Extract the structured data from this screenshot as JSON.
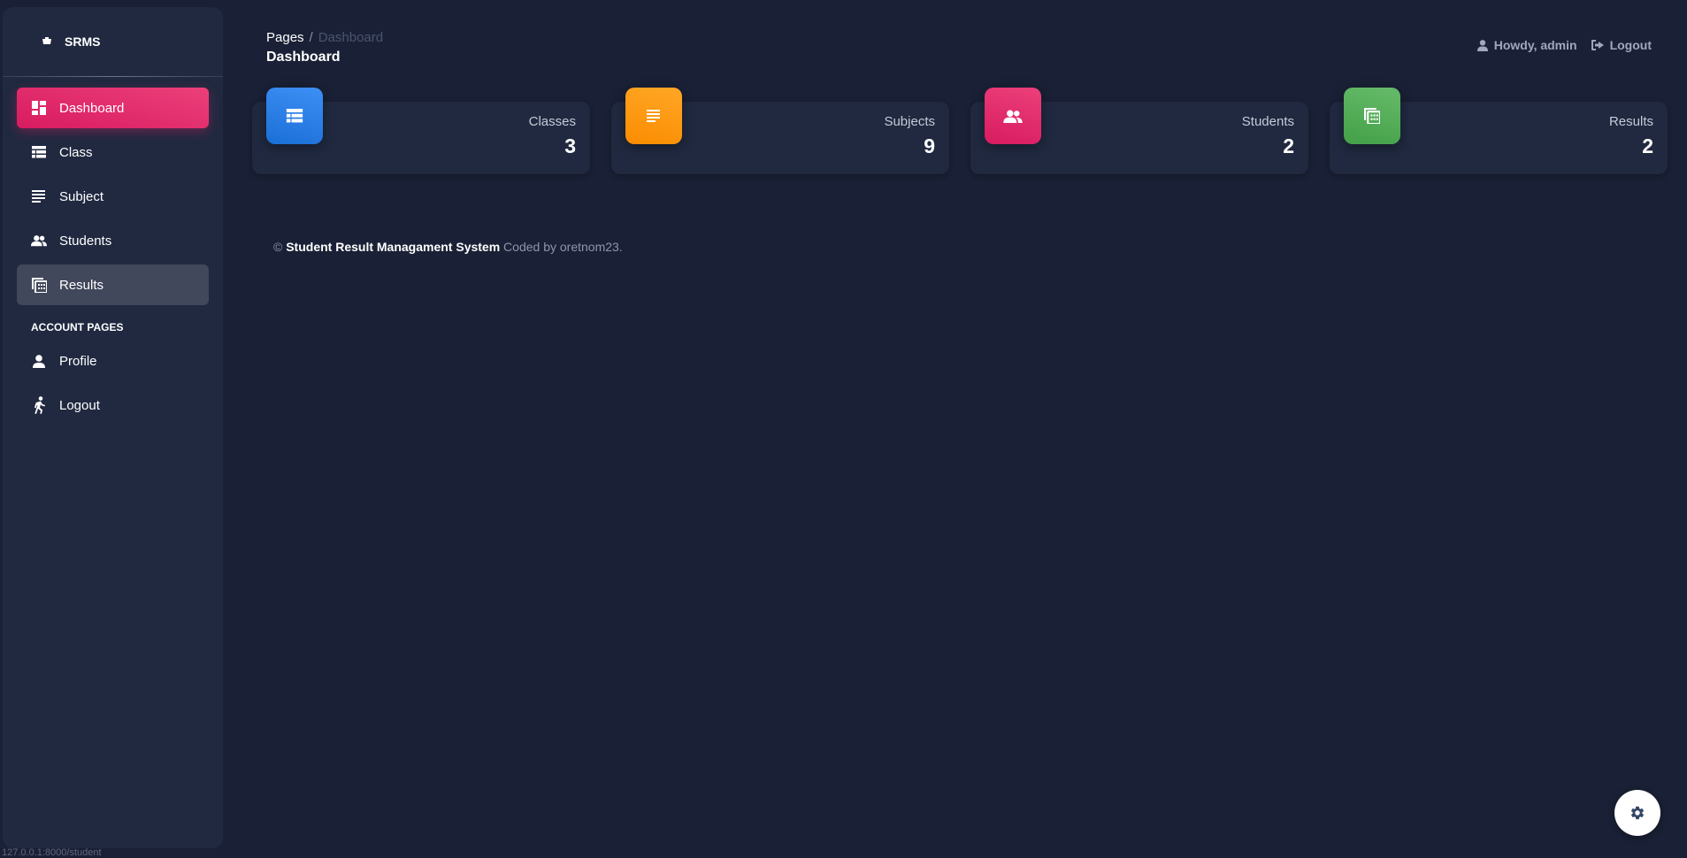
{
  "brand": {
    "name": "SRMS"
  },
  "sidebar": {
    "items": [
      {
        "label": "Dashboard",
        "icon": "dashboard-icon"
      },
      {
        "label": "Class",
        "icon": "table-rows-icon"
      },
      {
        "label": "Subject",
        "icon": "notes-icon"
      },
      {
        "label": "Students",
        "icon": "people-icon"
      },
      {
        "label": "Results",
        "icon": "results-icon"
      }
    ],
    "section_title": "ACCOUNT PAGES",
    "account_items": [
      {
        "label": "Profile",
        "icon": "person-icon"
      },
      {
        "label": "Logout",
        "icon": "run-icon"
      }
    ]
  },
  "header": {
    "breadcrumb_root": "Pages",
    "breadcrumb_separator": "/",
    "breadcrumb_current": "Dashboard",
    "title": "Dashboard",
    "greeting": "Howdy, admin",
    "logout": "Logout"
  },
  "cards": [
    {
      "label": "Classes",
      "value": "3",
      "color": "#2f80ed",
      "icon": "table-rows-icon"
    },
    {
      "label": "Subjects",
      "value": "9",
      "color": "#fb8c00",
      "icon": "notes-icon"
    },
    {
      "label": "Students",
      "value": "2",
      "color": "#e91e63",
      "icon": "people-icon"
    },
    {
      "label": "Results",
      "value": "2",
      "color": "#4caf50",
      "icon": "results-icon"
    }
  ],
  "footer": {
    "copyright": "©",
    "system_name": "Student Result Managament System",
    "coded_by": "Coded by oretnom23."
  },
  "statusbar": {
    "url": "127.0.0.1:8000/student"
  },
  "colors": {
    "background": "#1a2035",
    "panel": "#202940",
    "accent": "#e91e63"
  }
}
